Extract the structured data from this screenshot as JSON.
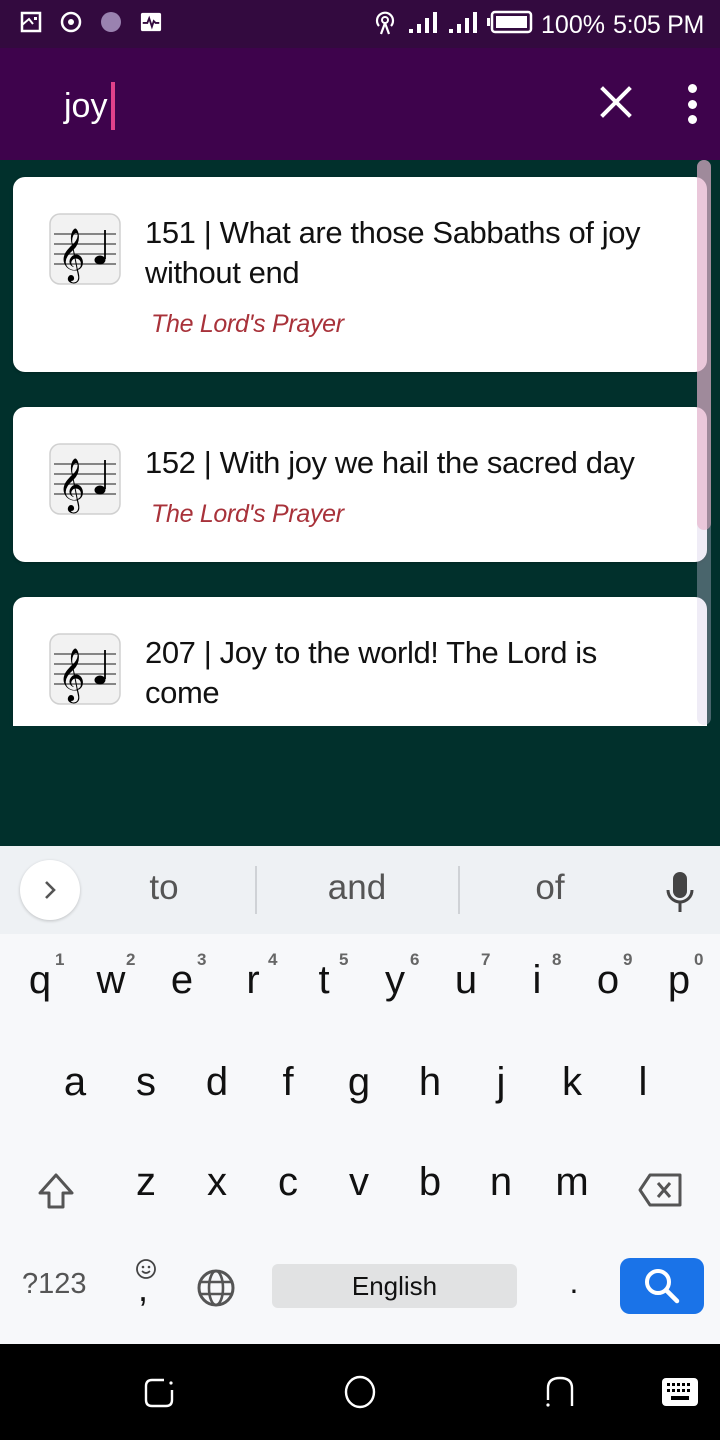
{
  "status_bar": {
    "left_icons": [
      "screenshot-icon",
      "record-icon",
      "app-circle-icon",
      "activity-icon"
    ],
    "right_icons": [
      "hotspot-icon",
      "signal-icon",
      "signal-icon",
      "battery-icon"
    ],
    "battery": "100%",
    "time": "5:05 PM"
  },
  "app_bar": {
    "search_value": "joy",
    "close_icon": "close-icon",
    "menu_icon": "more-vert-icon"
  },
  "results": [
    {
      "number": "151",
      "title": "151 | What are those Sabbaths of joy without end",
      "subtitle": "The Lord's Prayer",
      "icon": "music-note-icon"
    },
    {
      "number": "152",
      "title": "152 | With joy we hail the sacred day",
      "subtitle": "The Lord's Prayer",
      "icon": "music-note-icon"
    },
    {
      "number": "207",
      "title": "207 | Joy to the world! The Lord is come",
      "subtitle": "",
      "icon": "music-note-icon"
    }
  ],
  "scroll": {
    "visible_fraction": 0.65,
    "position": 0
  },
  "keyboard": {
    "suggestions": [
      "to",
      "and",
      "of"
    ],
    "row1": [
      "q",
      "w",
      "e",
      "r",
      "t",
      "y",
      "u",
      "i",
      "o",
      "p"
    ],
    "row1_hints": [
      "1",
      "2",
      "3",
      "4",
      "5",
      "6",
      "7",
      "8",
      "9",
      "0"
    ],
    "row2": [
      "a",
      "s",
      "d",
      "f",
      "g",
      "h",
      "j",
      "k",
      "l"
    ],
    "row3": [
      "z",
      "x",
      "c",
      "v",
      "b",
      "n",
      "m"
    ],
    "symbols_label": "?123",
    "comma": ",",
    "period": ".",
    "space_label": "English"
  },
  "nav_bar": {
    "buttons": [
      "recents-icon",
      "home-icon",
      "back-icon",
      "keyboard-switch-icon"
    ]
  },
  "colors": {
    "status_bar": "#330a3f",
    "app_bar": "#3e034c",
    "background": "#01302c",
    "caret": "#e0418a",
    "subtitle": "#a8323a",
    "search_key": "#1a73e8"
  }
}
